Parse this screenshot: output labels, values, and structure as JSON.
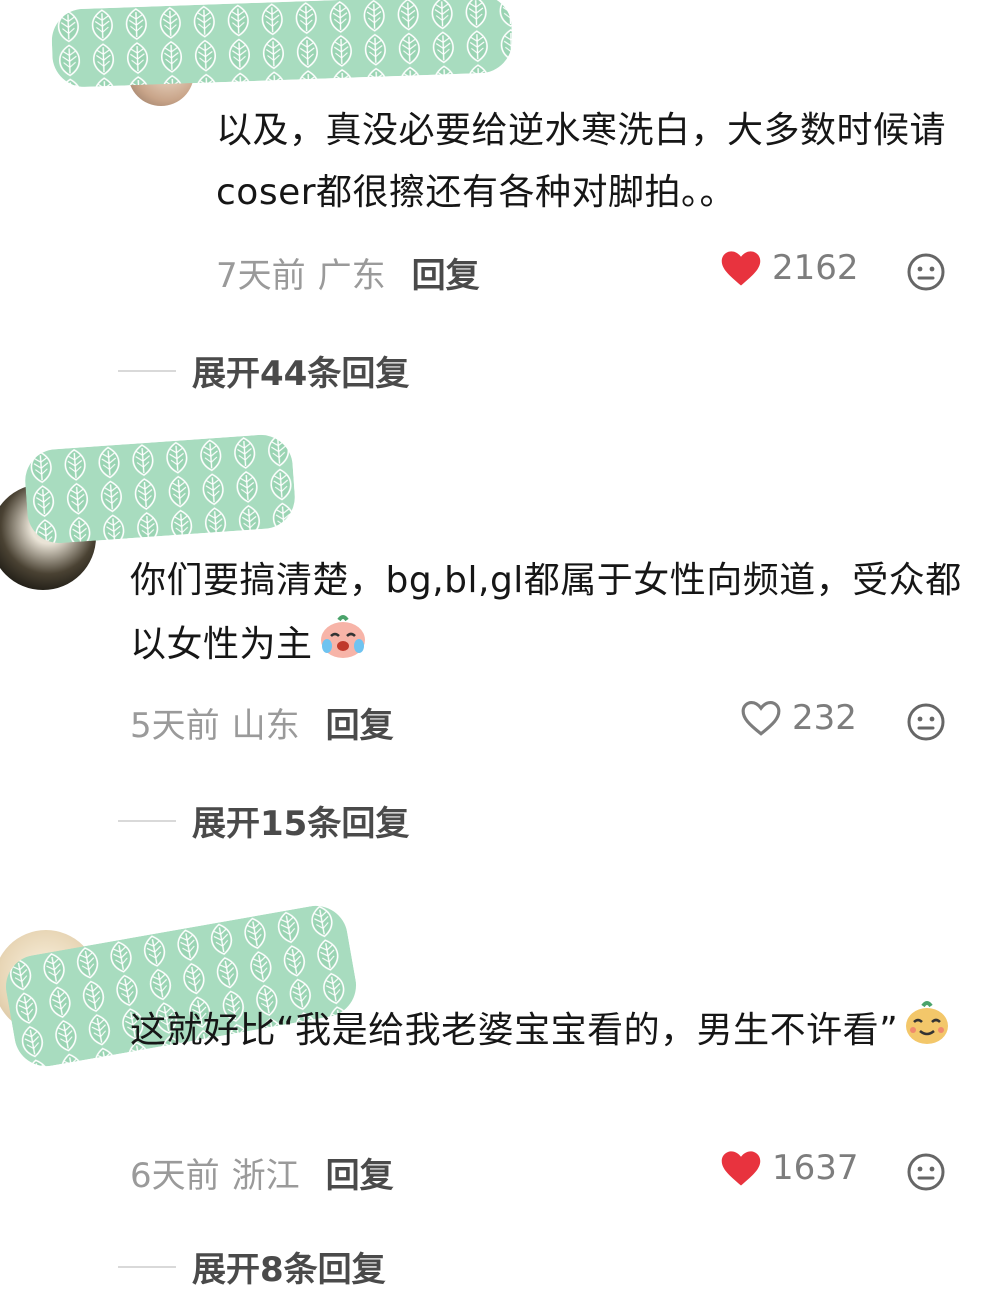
{
  "comments": [
    {
      "text": "以及，真没必要给逆水寒洗白，大多数时候请coser都很擦还有各种对脚拍。。",
      "time": "7天前",
      "location": "广东",
      "reply_label": "回复",
      "likes": "2162",
      "liked": true,
      "expand_label": "展开44条回复"
    },
    {
      "text": "你们要搞清楚，bg,bl,gl都属于女性向频道，受众都以女性为主",
      "emoji": "crying-laughing-sticker",
      "time": "5天前",
      "location": "山东",
      "reply_label": "回复",
      "likes": "232",
      "liked": false,
      "expand_label": "展开15条回复"
    },
    {
      "text": "这就好比“我是给我老婆宝宝看的，男生不许看”",
      "emoji": "smirk-sticker",
      "time": "6天前",
      "location": "浙江",
      "reply_label": "回复",
      "likes": "1637",
      "liked": true,
      "expand_label": "展开8条回复"
    }
  ],
  "colors": {
    "like_active": "#e8333e",
    "like_inactive": "#7d7d7d",
    "meta_text": "#9a9a9a",
    "censor_fill": "#a8dcbf"
  },
  "icons": {
    "like": "heart-icon",
    "reaction": "neutral-face-icon",
    "censor": "leaf-pattern-sticker"
  }
}
